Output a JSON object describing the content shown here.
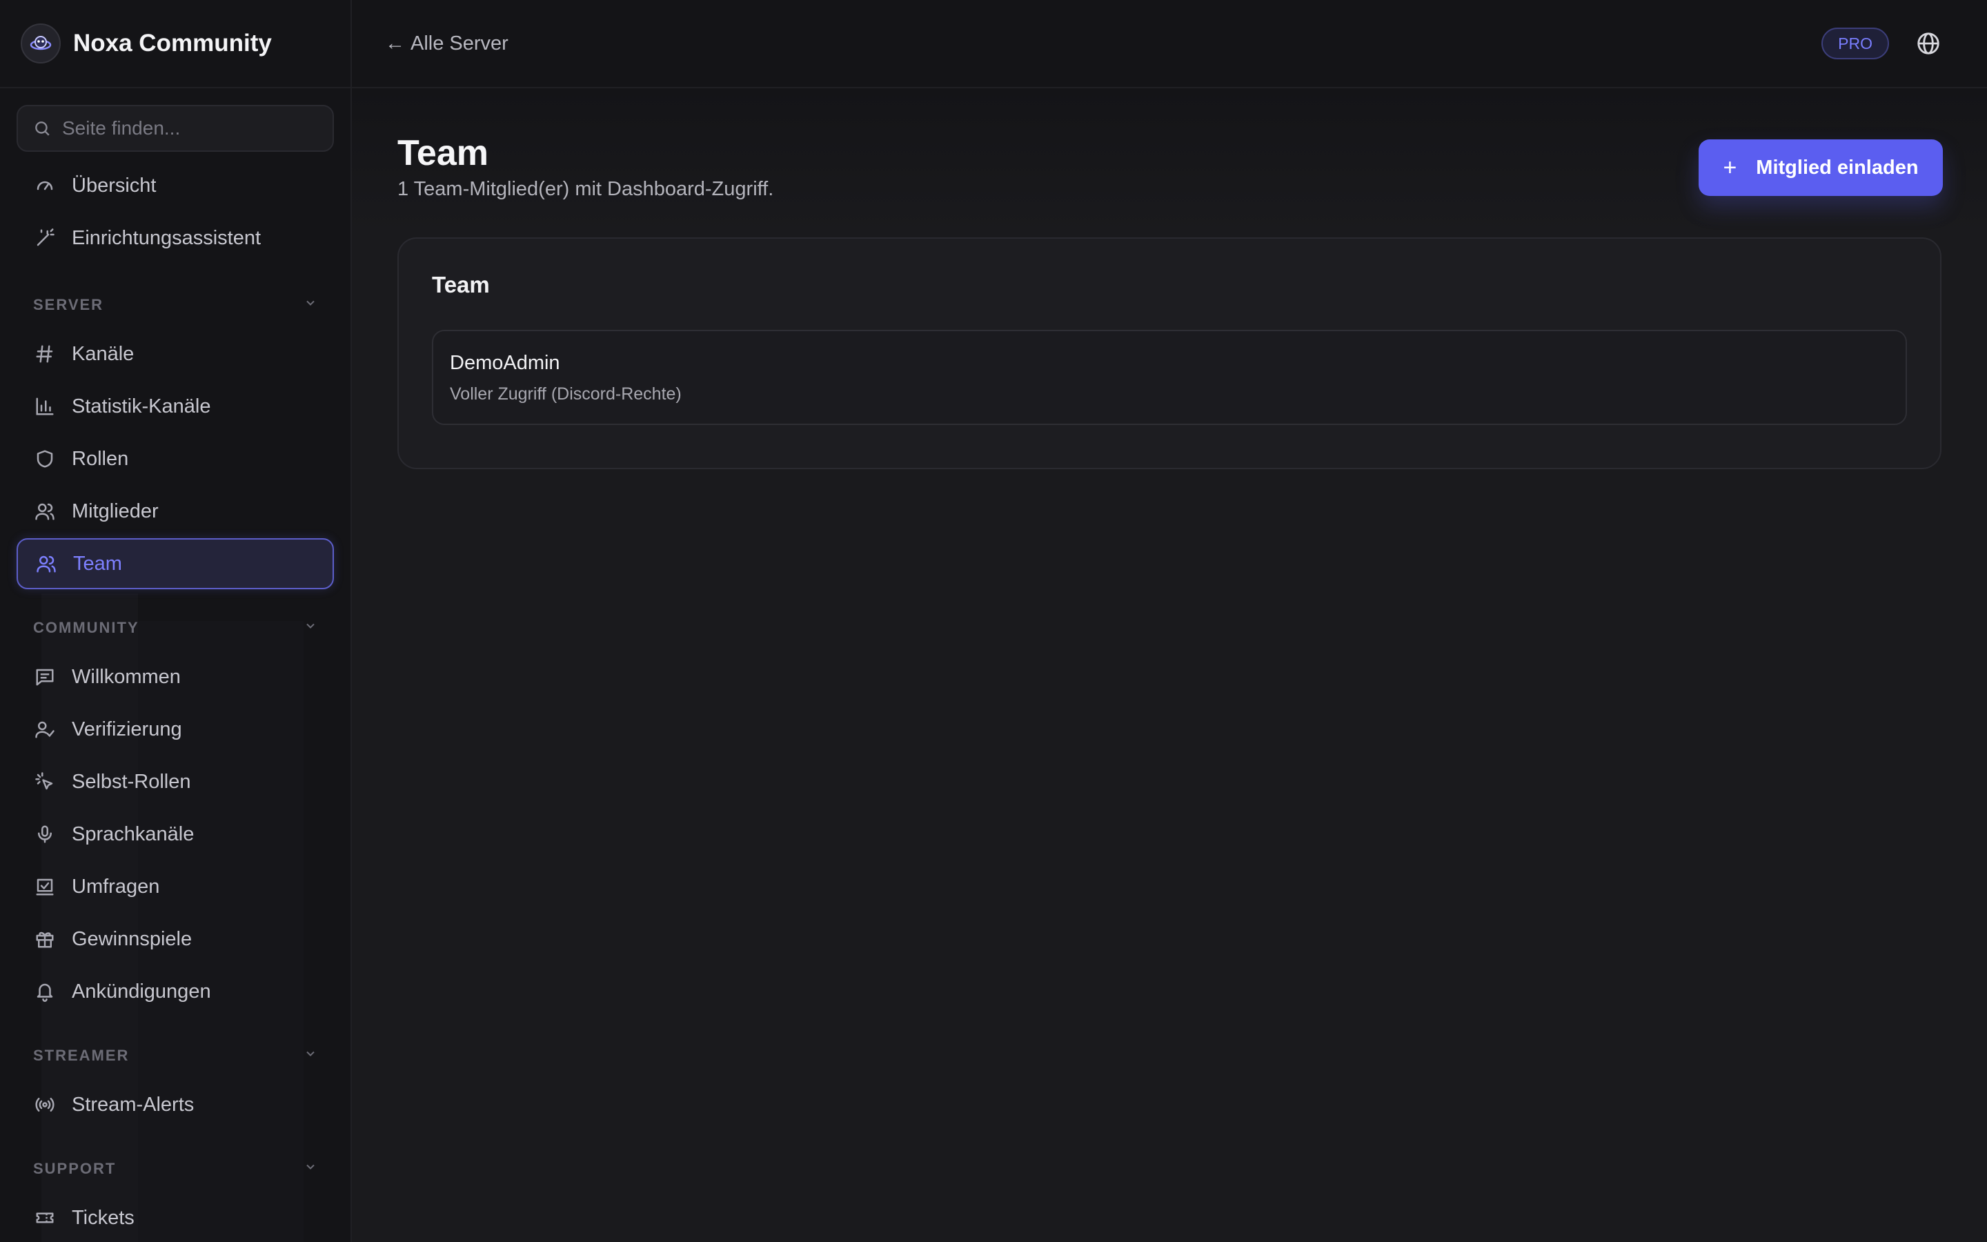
{
  "brand": {
    "name": "Noxa Community"
  },
  "search": {
    "placeholder": "Seite finden..."
  },
  "nav": {
    "top": [
      {
        "label": "Übersicht",
        "icon": "gauge-icon"
      },
      {
        "label": "Einrichtungsassistent",
        "icon": "magic-wand-icon"
      }
    ],
    "sections": [
      {
        "title": "SERVER",
        "items": [
          {
            "label": "Kanäle",
            "icon": "hash-icon"
          },
          {
            "label": "Statistik-Kanäle",
            "icon": "bar-chart-icon"
          },
          {
            "label": "Rollen",
            "icon": "shield-icon"
          },
          {
            "label": "Mitglieder",
            "icon": "users-icon"
          },
          {
            "label": "Team",
            "icon": "users-icon",
            "active": true
          }
        ]
      },
      {
        "title": "COMMUNITY",
        "items": [
          {
            "label": "Willkommen",
            "icon": "message-icon"
          },
          {
            "label": "Verifizierung",
            "icon": "user-check-icon"
          },
          {
            "label": "Selbst-Rollen",
            "icon": "pointer-click-icon"
          },
          {
            "label": "Sprachkanäle",
            "icon": "microphone-icon"
          },
          {
            "label": "Umfragen",
            "icon": "poll-icon"
          },
          {
            "label": "Gewinnspiele",
            "icon": "gift-icon"
          },
          {
            "label": "Ankündigungen",
            "icon": "bell-icon"
          }
        ]
      },
      {
        "title": "STREAMER",
        "items": [
          {
            "label": "Stream-Alerts",
            "icon": "broadcast-icon"
          }
        ]
      },
      {
        "title": "SUPPORT",
        "items": [
          {
            "label": "Tickets",
            "icon": "ticket-icon"
          }
        ]
      }
    ]
  },
  "topbar": {
    "back_label": "Alle Server",
    "back_arrow": "←",
    "badge": "PRO"
  },
  "page": {
    "title": "Team",
    "subtitle": "1 Team-Mitglied(er) mit Dashboard-Zugriff.",
    "invite_label": "Mitglied einladen",
    "invite_icon": "+"
  },
  "team_card": {
    "title": "Team",
    "members": [
      {
        "name": "DemoAdmin",
        "role": "Voller Zugriff (Discord-Rechte)"
      }
    ]
  },
  "colors": {
    "accent": "#5b5ef0",
    "active_text": "#7d80ff",
    "background": "#1a1a1d",
    "sidebar": "#141417"
  }
}
